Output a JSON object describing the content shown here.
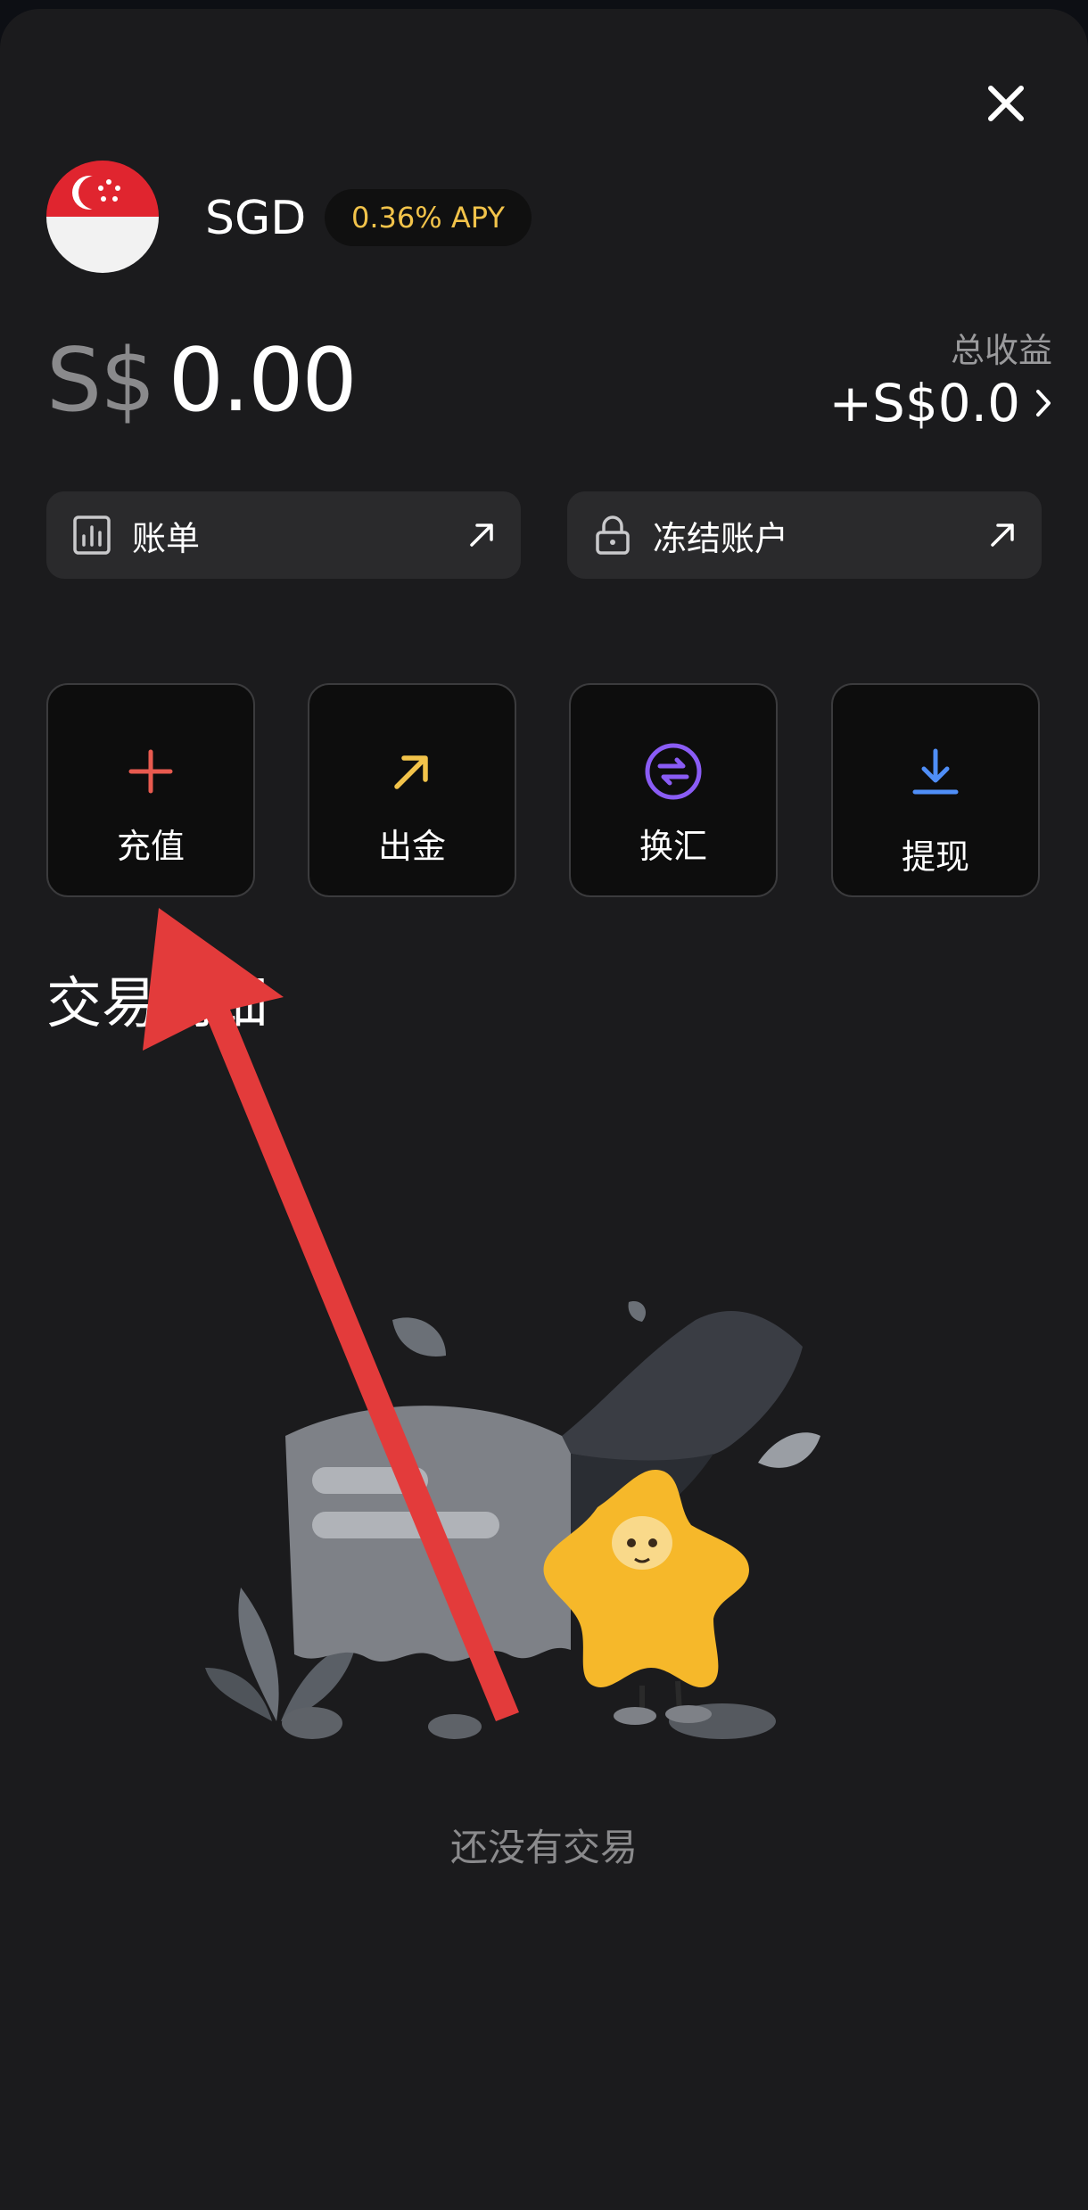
{
  "header": {
    "close_icon": "close-icon"
  },
  "account": {
    "currency": "SGD",
    "apy_badge": "0.36% APY",
    "flag_icon": "singapore-flag-icon",
    "balance_symbol": "S$",
    "balance_amount": "0.00",
    "total_earnings_label": "总收益",
    "total_earnings_value": "+S$0.0"
  },
  "quick_links": [
    {
      "label": "账单",
      "icon": "bar-chart-icon"
    },
    {
      "label": "冻结账户",
      "icon": "lock-icon"
    }
  ],
  "actions": [
    {
      "label": "充值",
      "icon": "plus-icon",
      "color": "#e85a4f"
    },
    {
      "label": "出金",
      "icon": "arrow-up-right-icon",
      "color": "#f2c34a"
    },
    {
      "label": "换汇",
      "icon": "exchange-icon",
      "color": "#8a5cf5"
    },
    {
      "label": "提现",
      "icon": "download-icon",
      "color": "#4f8ef7"
    }
  ],
  "transactions": {
    "title": "交易明细",
    "empty_text": "还没有交易"
  },
  "colors": {
    "accent_yellow": "#f2c34a",
    "background": "#1b1b1d",
    "annotation_arrow": "#e33b3b"
  }
}
